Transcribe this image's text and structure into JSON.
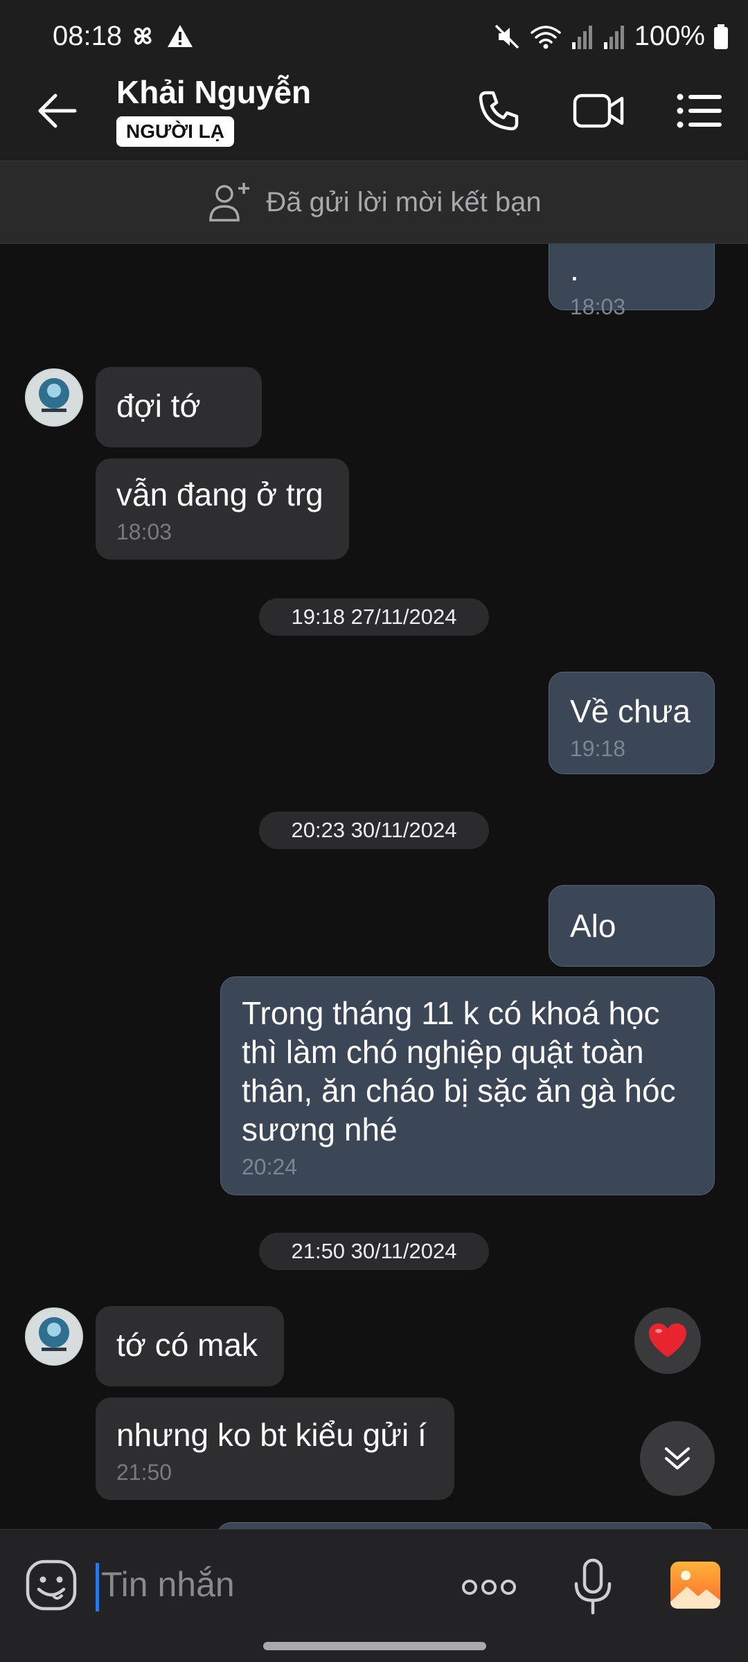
{
  "status_bar": {
    "time": "08:18",
    "battery": "100%"
  },
  "header": {
    "contact_name": "Khải Nguyễn",
    "badge": "NGƯỜI LẠ"
  },
  "friend_request": {
    "text": "Đã gửi lời mời kết bạn"
  },
  "messages": {
    "m0": {
      "text": ".",
      "time": "18:03"
    },
    "m1": {
      "text": "đợi tớ"
    },
    "m2": {
      "text": "vẫn đang ở trg",
      "time": "18:03"
    },
    "d1": "19:18 27/11/2024",
    "m3": {
      "text": "Về chưa",
      "time": "19:18"
    },
    "d2": "20:23 30/11/2024",
    "m4": {
      "text": "Alo"
    },
    "m5": {
      "text": "Trong tháng 11 k có khoá học thì làm chó nghiệp quật toàn thân, ăn cháo bị sặc ăn gà hóc sương nhé",
      "time": "20:24"
    },
    "d3": "21:50 30/11/2024",
    "m6": {
      "text": "tớ có mak"
    },
    "m7": {
      "text": "nhưng ko bt kiểu gửi í",
      "time": "21:50"
    }
  },
  "composer": {
    "placeholder": "Tin nhắn"
  },
  "colors": {
    "outgoing_bubble": "#3b4757",
    "incoming_bubble": "#2e2e30",
    "accent": "#1a7cff"
  }
}
